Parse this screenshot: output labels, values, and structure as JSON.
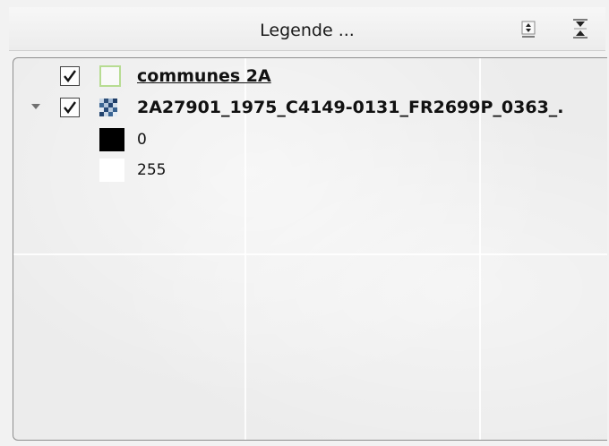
{
  "panel": {
    "title": "Legende ...",
    "expand_icon": "expand-all-icon",
    "collapse_icon": "collapse-all-icon"
  },
  "layers": [
    {
      "name": "communes 2A",
      "checked": true,
      "type_icon": "vector-polygon-icon",
      "symbol_color": "#b7dc92"
    },
    {
      "name": "2A27901_1975_C4149-0131_FR2699P_0363_.",
      "checked": true,
      "type_icon": "raster-layer-icon",
      "legend": [
        {
          "label": "0",
          "color": "#000000"
        },
        {
          "label": "255",
          "color": "#ffffff"
        }
      ]
    }
  ]
}
